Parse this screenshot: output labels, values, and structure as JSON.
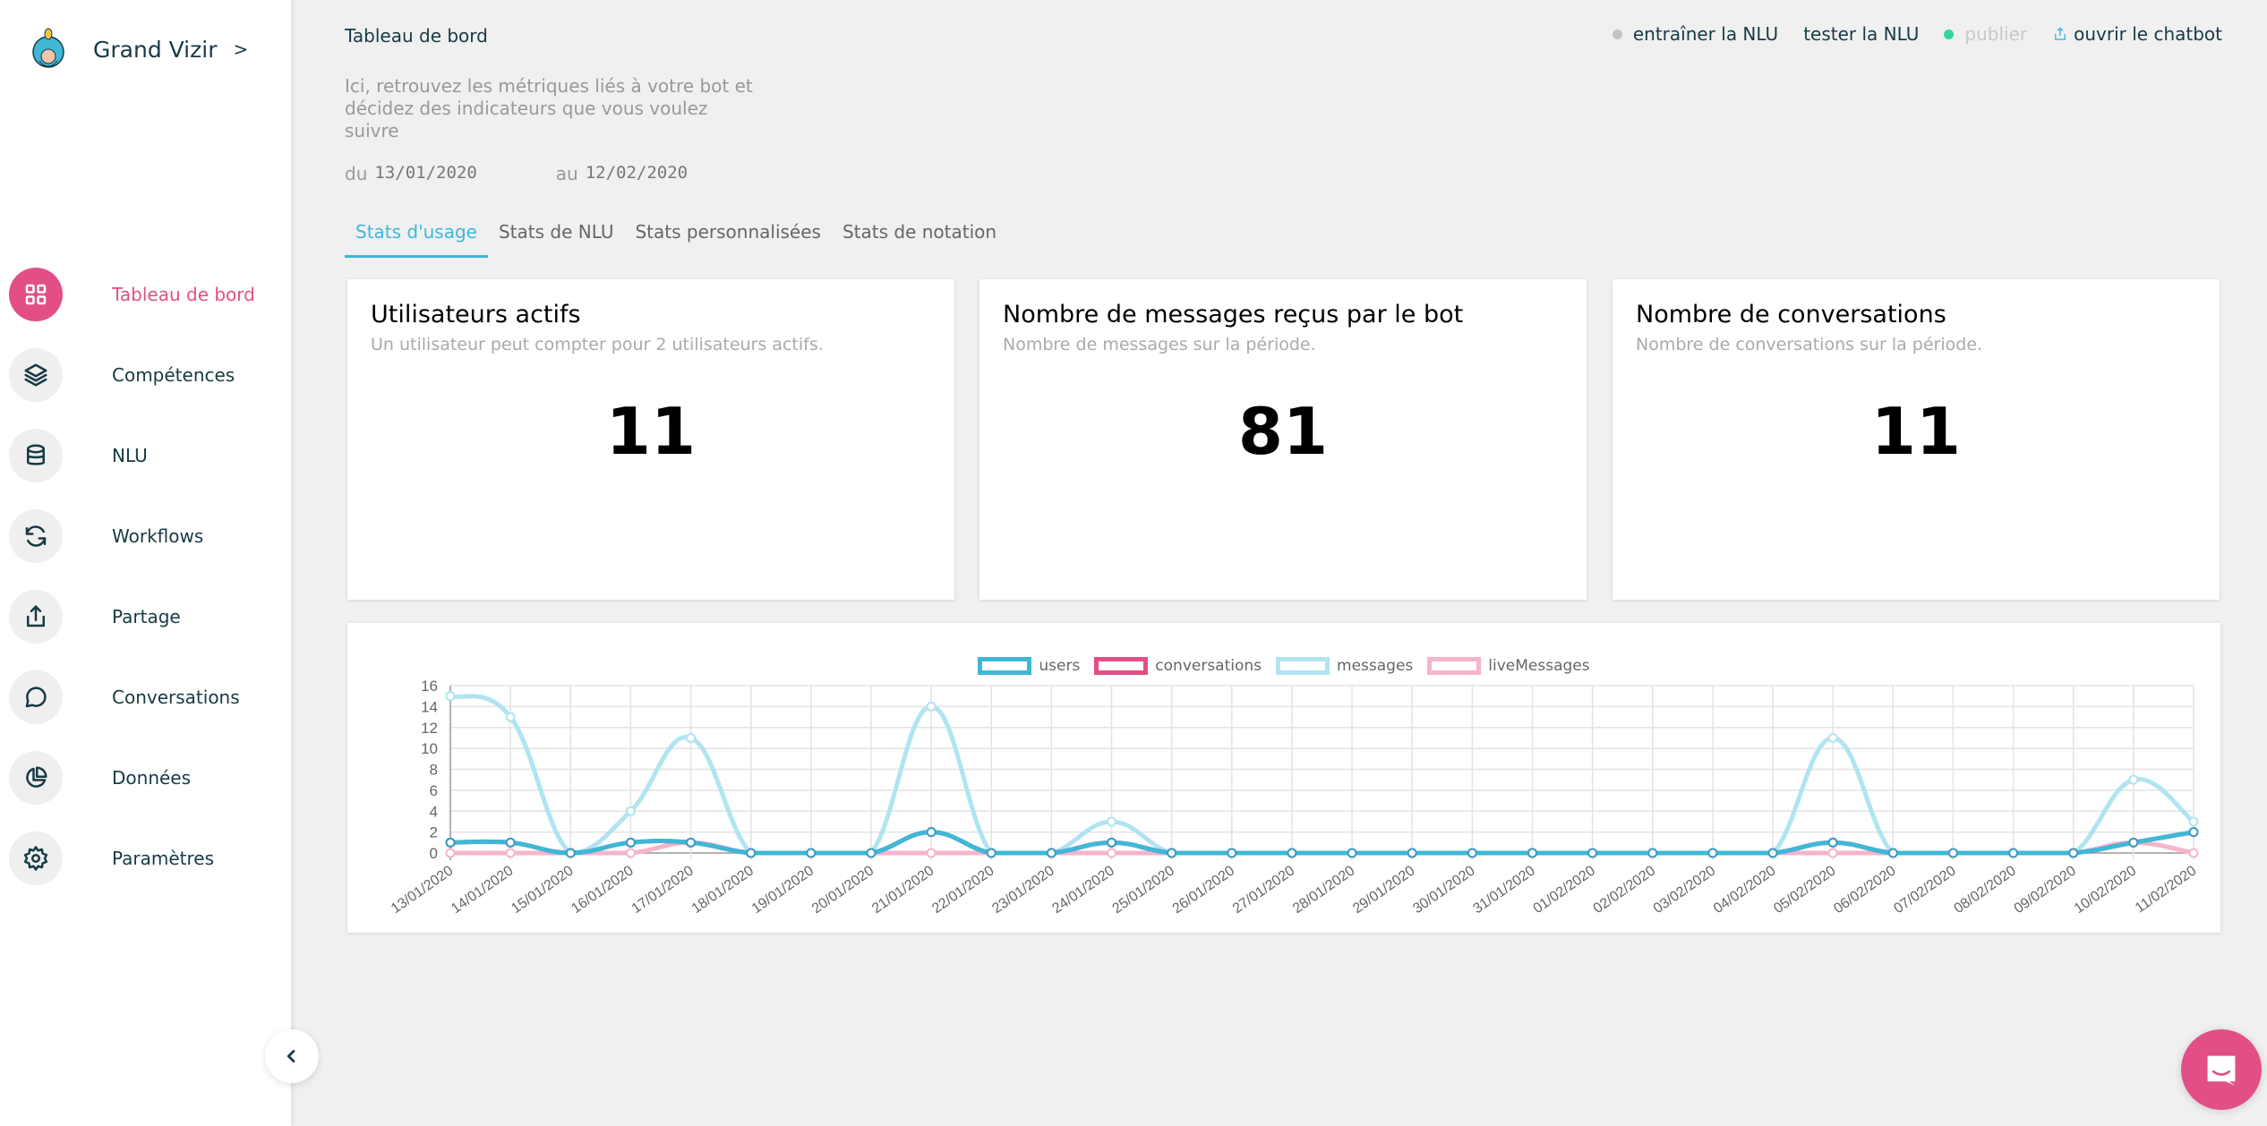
{
  "app": {
    "name": "Grand Vizir",
    "chevron": ">"
  },
  "sidebar": {
    "items": [
      {
        "label": "Tableau de bord",
        "icon": "dashboard-grid-icon",
        "active": true
      },
      {
        "label": "Compétences",
        "icon": "layers-icon"
      },
      {
        "label": "NLU",
        "icon": "database-icon"
      },
      {
        "label": "Workflows",
        "icon": "refresh-cycle-icon"
      },
      {
        "label": "Partage",
        "icon": "share-upload-icon"
      },
      {
        "label": "Conversations",
        "icon": "chat-bubble-icon"
      },
      {
        "label": "Données",
        "icon": "pie-chart-icon"
      },
      {
        "label": "Paramètres",
        "icon": "gear-icon"
      }
    ],
    "collapse_icon": "chevron-left-icon"
  },
  "header": {
    "title": "Tableau de bord",
    "description": "Ici, retrouvez les métriques liés à votre bot et décidez des indicateurs que vous voulez suivre",
    "from_label": "du",
    "from_date": "13/01/2020",
    "to_label": "au",
    "to_date": "12/02/2020"
  },
  "actions": {
    "train": {
      "label": "entraîner la NLU",
      "status_color": "#c4c4c4"
    },
    "test": {
      "label": "tester la NLU"
    },
    "publish": {
      "label": "publier",
      "status_color": "#2ed8a0",
      "disabled": true
    },
    "open": {
      "label": "ouvrir le chatbot",
      "icon": "share-upload-icon"
    }
  },
  "tabs": [
    {
      "label": "Stats d'usage",
      "active": true
    },
    {
      "label": "Stats de NLU"
    },
    {
      "label": "Stats personnalisées"
    },
    {
      "label": "Stats de notation"
    }
  ],
  "cards": [
    {
      "title": "Utilisateurs actifs",
      "subtitle": "Un utilisateur peut compter pour 2 utilisateurs actifs.",
      "value": "11"
    },
    {
      "title": "Nombre de messages reçus par le bot",
      "subtitle": "Nombre de messages sur la période.",
      "value": "81"
    },
    {
      "title": "Nombre de conversations",
      "subtitle": "Nombre de conversations sur la période.",
      "value": "11"
    }
  ],
  "colors": {
    "accent": "#e24f86",
    "tab_active": "#3fb8d6"
  },
  "chart_data": {
    "type": "line",
    "title": "",
    "xlabel": "",
    "ylabel": "",
    "ylim": [
      0,
      16
    ],
    "yticks": [
      0,
      2,
      4,
      6,
      8,
      10,
      12,
      14,
      16
    ],
    "grid": true,
    "legend": "top-center",
    "x": [
      "13/01/2020",
      "14/01/2020",
      "15/01/2020",
      "16/01/2020",
      "17/01/2020",
      "18/01/2020",
      "19/01/2020",
      "20/01/2020",
      "21/01/2020",
      "22/01/2020",
      "23/01/2020",
      "24/01/2020",
      "25/01/2020",
      "26/01/2020",
      "27/01/2020",
      "28/01/2020",
      "29/01/2020",
      "30/01/2020",
      "31/01/2020",
      "01/02/2020",
      "02/02/2020",
      "03/02/2020",
      "04/02/2020",
      "05/02/2020",
      "06/02/2020",
      "07/02/2020",
      "08/02/2020",
      "09/02/2020",
      "10/02/2020",
      "11/02/2020"
    ],
    "series": [
      {
        "name": "liveMessages",
        "color": "#f5b4cc",
        "values": [
          0,
          0,
          0,
          0,
          1,
          0,
          0,
          0,
          0,
          0,
          0,
          0,
          0,
          0,
          0,
          0,
          0,
          0,
          0,
          0,
          0,
          0,
          0,
          0,
          0,
          0,
          0,
          0,
          1,
          0
        ]
      },
      {
        "name": "messages",
        "color": "#b0e4f0",
        "values": [
          15,
          13,
          0,
          4,
          11,
          0,
          0,
          0,
          14,
          0,
          0,
          3,
          0,
          0,
          0,
          0,
          0,
          0,
          0,
          0,
          0,
          0,
          0,
          11,
          0,
          0,
          0,
          0,
          7,
          3
        ]
      },
      {
        "name": "conversations",
        "color": "#e24f86",
        "values": [
          1,
          1,
          0,
          1,
          1,
          0,
          0,
          0,
          2,
          0,
          0,
          1,
          0,
          0,
          0,
          0,
          0,
          0,
          0,
          0,
          0,
          0,
          0,
          1,
          0,
          0,
          0,
          0,
          1,
          2
        ]
      },
      {
        "name": "users",
        "color": "#3fb8d6",
        "values": [
          1,
          1,
          0,
          1,
          1,
          0,
          0,
          0,
          2,
          0,
          0,
          1,
          0,
          0,
          0,
          0,
          0,
          0,
          0,
          0,
          0,
          0,
          0,
          1,
          0,
          0,
          0,
          0,
          1,
          2
        ]
      }
    ],
    "legend_order": [
      "users",
      "conversations",
      "messages",
      "liveMessages"
    ]
  }
}
